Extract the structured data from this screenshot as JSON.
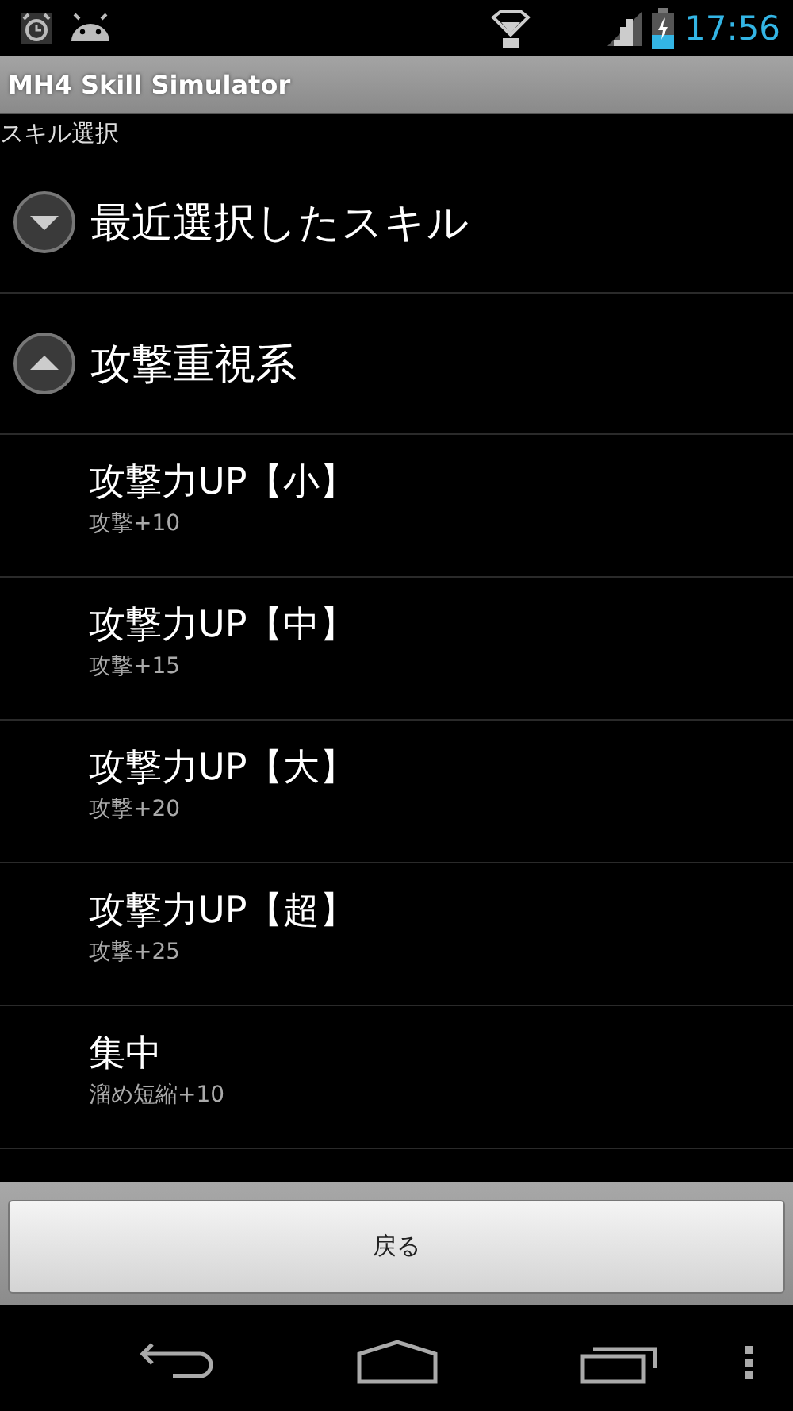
{
  "status_bar": {
    "time": "17:56"
  },
  "title_bar": {
    "title": "MH4 Skill Simulator"
  },
  "subtitle": "スキル選択",
  "groups": [
    {
      "label": "最近選択したスキル",
      "expanded": false
    },
    {
      "label": "攻撃重視系",
      "expanded": true,
      "children": [
        {
          "name": "攻撃力UP【小】",
          "effect": "攻撃+10"
        },
        {
          "name": "攻撃力UP【中】",
          "effect": "攻撃+15"
        },
        {
          "name": "攻撃力UP【大】",
          "effect": "攻撃+20"
        },
        {
          "name": "攻撃力UP【超】",
          "effect": "攻撃+25"
        },
        {
          "name": "集中",
          "effect": "溜め短縮+10"
        }
      ]
    }
  ],
  "button": "戻る"
}
